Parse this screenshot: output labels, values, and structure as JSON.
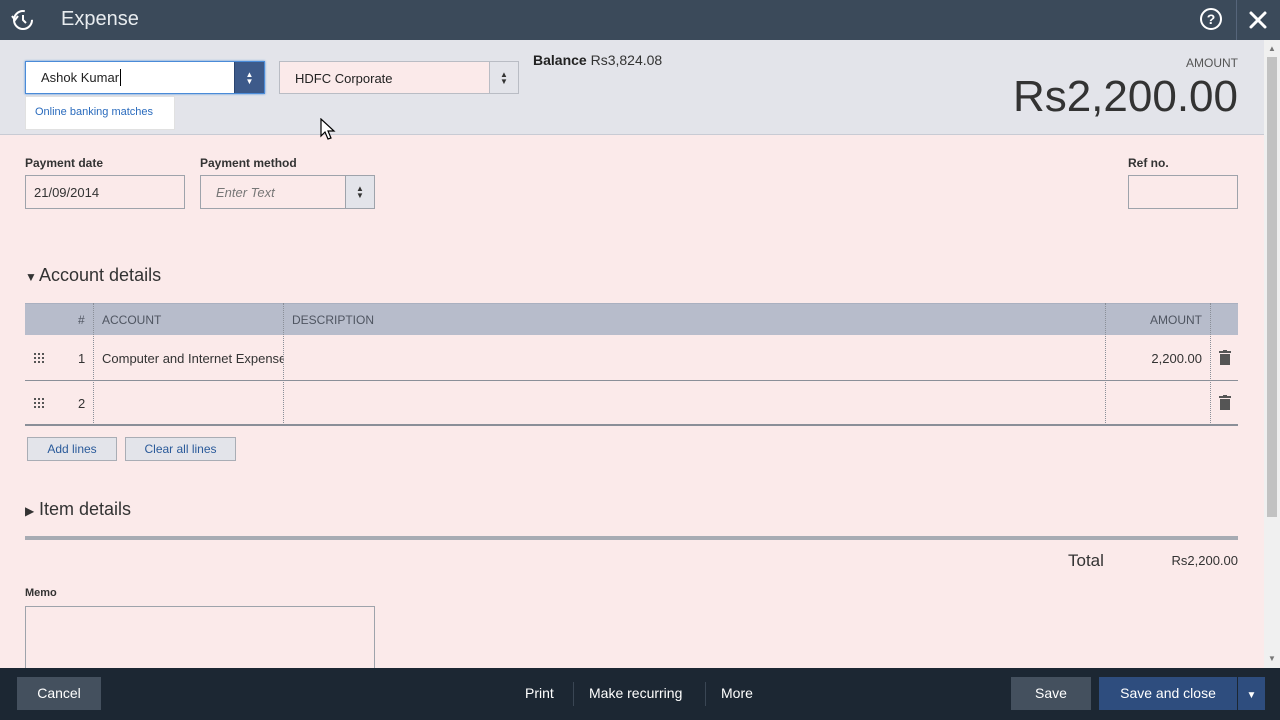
{
  "window": {
    "title": "Expense"
  },
  "payee": {
    "value": "Ashok Kumar"
  },
  "payment_account": {
    "value": "HDFC Corporate"
  },
  "suggestion": {
    "label": "Online banking matches"
  },
  "balance": {
    "label": "Balance",
    "value": "Rs3,824.08"
  },
  "amount": {
    "label": "AMOUNT",
    "value": "Rs2,200.00"
  },
  "payment_date": {
    "label": "Payment date",
    "value": "21/09/2014"
  },
  "payment_method": {
    "label": "Payment method",
    "placeholder": "Enter Text"
  },
  "ref_no": {
    "label": "Ref no.",
    "value": ""
  },
  "account_details": {
    "title": "Account details",
    "columns": {
      "num": "#",
      "account": "ACCOUNT",
      "description": "DESCRIPTION",
      "amount": "AMOUNT"
    },
    "rows": [
      {
        "num": "1",
        "account": "Computer and Internet Expense",
        "description": "",
        "amount": "2,200.00"
      },
      {
        "num": "2",
        "account": "",
        "description": "",
        "amount": ""
      }
    ],
    "add_lines_label": "Add lines",
    "clear_lines_label": "Clear all lines"
  },
  "item_details": {
    "title": "Item details"
  },
  "total": {
    "label": "Total",
    "value": "Rs2,200.00"
  },
  "memo": {
    "label": "Memo",
    "value": ""
  },
  "footer": {
    "cancel_label": "Cancel",
    "print_label": "Print",
    "recurring_label": "Make recurring",
    "more_label": "More",
    "save_label": "Save",
    "save_close_label": "Save and close"
  },
  "colors": {
    "titlebar": "#3b4a5a",
    "footer": "#1c2733",
    "primary_button": "#2e4d7e",
    "form_bg": "#fbeaea"
  }
}
